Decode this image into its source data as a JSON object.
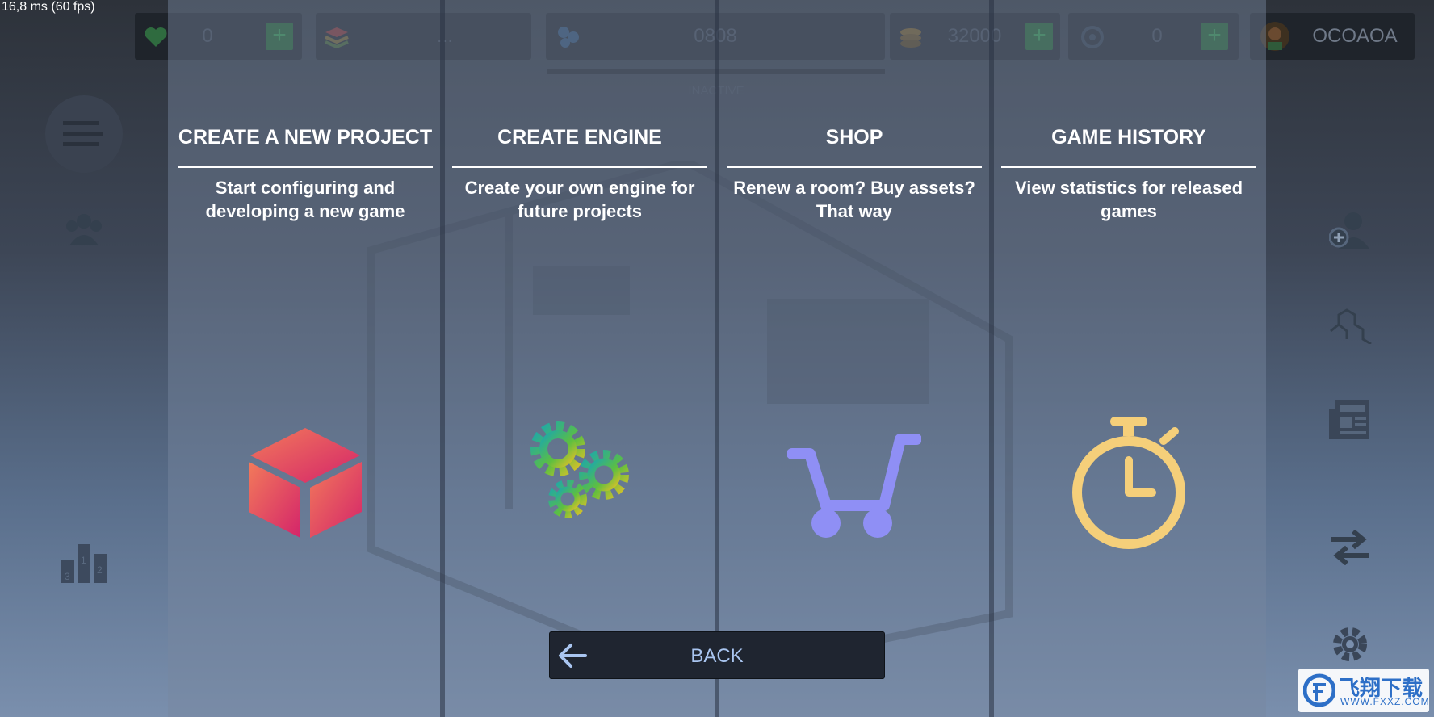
{
  "fps_counter": "16,8 ms (60 fps)",
  "hud": {
    "hearts": "0",
    "layers": "...",
    "clock": "0808",
    "status": "INACTIVE",
    "coins": "32000",
    "research": "0",
    "player_name": "OCOAOA"
  },
  "columns": [
    {
      "title": "CREATE A NEW PROJECT",
      "desc": "Start configuring and developing a new game",
      "icon": "cube-icon"
    },
    {
      "title": "CREATE ENGINE",
      "desc": "Create your own engine for future projects",
      "icon": "gears-icon"
    },
    {
      "title": "SHOP",
      "desc": "Renew a room? Buy assets? That way",
      "icon": "cart-icon"
    },
    {
      "title": "GAME HISTORY",
      "desc": "View statistics for released games",
      "icon": "stopwatch-icon"
    }
  ],
  "back_label": "BACK",
  "watermark": {
    "line1": "飞翔下载",
    "line2": "WWW.FXXZ.COM"
  },
  "colors": {
    "accent": "#a9c5f0",
    "cube": "#e8475f",
    "cart": "#8f8ff5",
    "stopwatch": "#f5cf7a"
  }
}
